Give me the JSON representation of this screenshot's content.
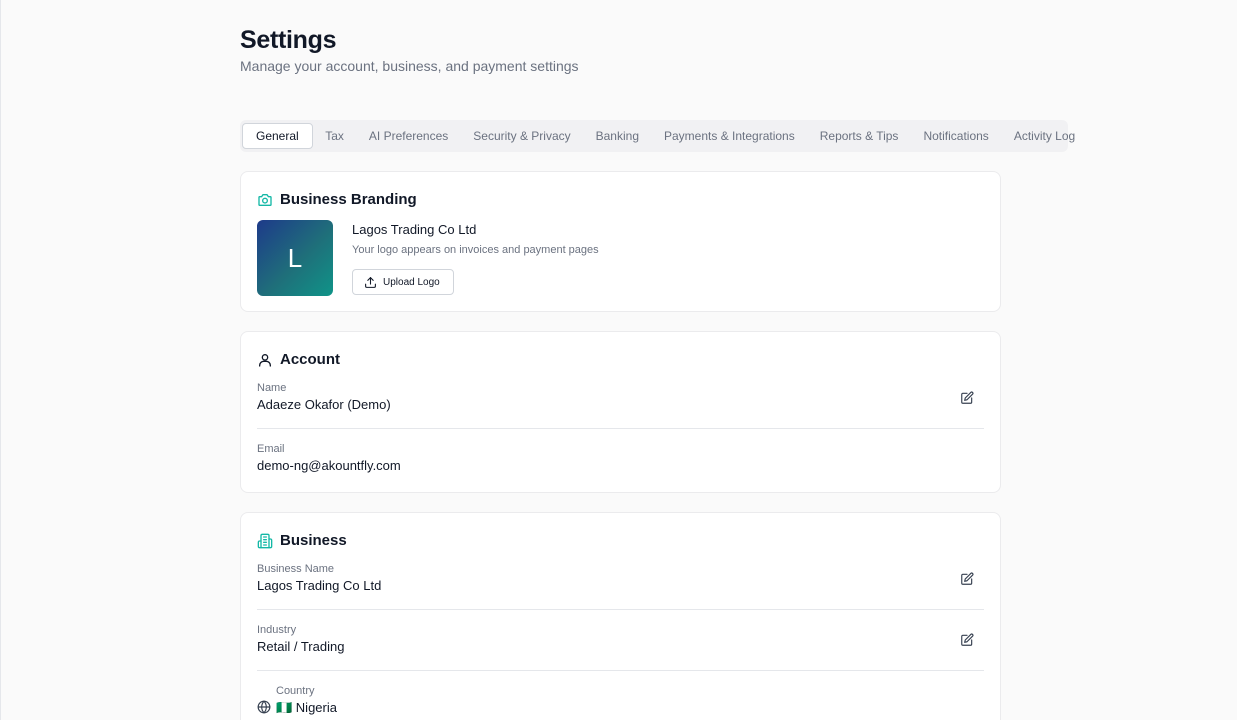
{
  "header": {
    "title": "Settings",
    "subtitle": "Manage your account, business, and payment settings"
  },
  "tabs": [
    {
      "label": "General",
      "active": true
    },
    {
      "label": "Tax"
    },
    {
      "label": "AI Preferences"
    },
    {
      "label": "Security & Privacy"
    },
    {
      "label": "Banking"
    },
    {
      "label": "Payments & Integrations"
    },
    {
      "label": "Reports & Tips"
    },
    {
      "label": "Notifications"
    },
    {
      "label": "Activity Log"
    }
  ],
  "branding": {
    "title": "Business Branding",
    "icon": "camera-icon",
    "logo_letter": "L",
    "business_name": "Lagos Trading Co Ltd",
    "description": "Your logo appears on invoices and payment pages",
    "upload_label": "Upload Logo",
    "upload_icon": "upload-icon",
    "logo_gradient": [
      "#1e3a8a",
      "#0f9488"
    ]
  },
  "account": {
    "title": "Account",
    "icon": "user-icon",
    "name_label": "Name",
    "name_value": "Adaeze Okafor (Demo)",
    "email_label": "Email",
    "email_value": "demo-ng@akountfly.com"
  },
  "business": {
    "title": "Business",
    "icon": "building-icon",
    "business_name_label": "Business Name",
    "business_name_value": "Lagos Trading Co Ltd",
    "industry_label": "Industry",
    "industry_value": "Retail / Trading",
    "country_label": "Country",
    "country_value": "🇳🇬 Nigeria",
    "country_icon": "globe-icon"
  },
  "colors": {
    "accent": "#14b8a6",
    "text": "#111827",
    "muted": "#6b7280"
  }
}
